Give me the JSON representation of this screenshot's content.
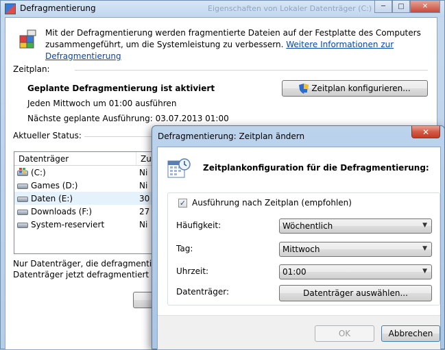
{
  "main_window": {
    "title": "Defragmentierung",
    "ghost_title": "Eigenschaften von Lokaler Datenträger (C:)",
    "intro_line1": "Mit der Defragmentierung werden fragmentierte Dateien auf der Festplatte des Computers",
    "intro_line2": "zusammengeführt, um die Systemleistung zu verbessern.",
    "intro_link": "Weitere Informationen zur Defragmentierung",
    "schedule_label": "Zeitplan:",
    "schedule_status": "Geplante Defragmentierung ist aktiviert",
    "schedule_when": "Jeden Mittwoch um 01:00 ausführen",
    "next_run": "Nächste geplante Ausführung: 03.07.2013 01:00",
    "configure_button": "Zeitplan konfigurieren...",
    "current_status_label": "Aktueller Status:",
    "list_headers": [
      "Datenträger",
      "Zu"
    ],
    "drives": [
      {
        "name": "(C:)",
        "status": "Ni",
        "icon": "windows-drive-icon"
      },
      {
        "name": "Games (D:)",
        "status": "Ni",
        "icon": "drive-icon"
      },
      {
        "name": "Daten (E:)",
        "status": "30",
        "icon": "drive-icon"
      },
      {
        "name": "Downloads (F:)",
        "status": "27",
        "icon": "drive-icon"
      },
      {
        "name": "System-reserviert",
        "status": "Ni",
        "icon": "drive-icon"
      }
    ],
    "footer_line1": "Nur Datenträger, die defragmentiert w",
    "footer_line2": "Datenträger jetzt defragmentiert werde"
  },
  "dialog": {
    "title": "Defragmentierung: Zeitplan ändern",
    "heading": "Zeitplankonfiguration für die Defragmentierung:",
    "run_on_schedule_label": "Ausführung nach Zeitplan (empfohlen)",
    "run_on_schedule_checked": "✓",
    "frequency_label": "Häufigkeit:",
    "frequency_value": "Wöchentlich",
    "day_label": "Tag:",
    "day_value": "Mittwoch",
    "time_label": "Uhrzeit:",
    "time_value": "01:00",
    "disks_label": "Datenträger:",
    "select_disks_button": "Datenträger auswählen...",
    "ok_button": "OK",
    "cancel_button": "Abbrechen"
  },
  "colors": {
    "link": "#0645ad",
    "close_button": "#c33b25",
    "selection": "#e5f1fb"
  }
}
